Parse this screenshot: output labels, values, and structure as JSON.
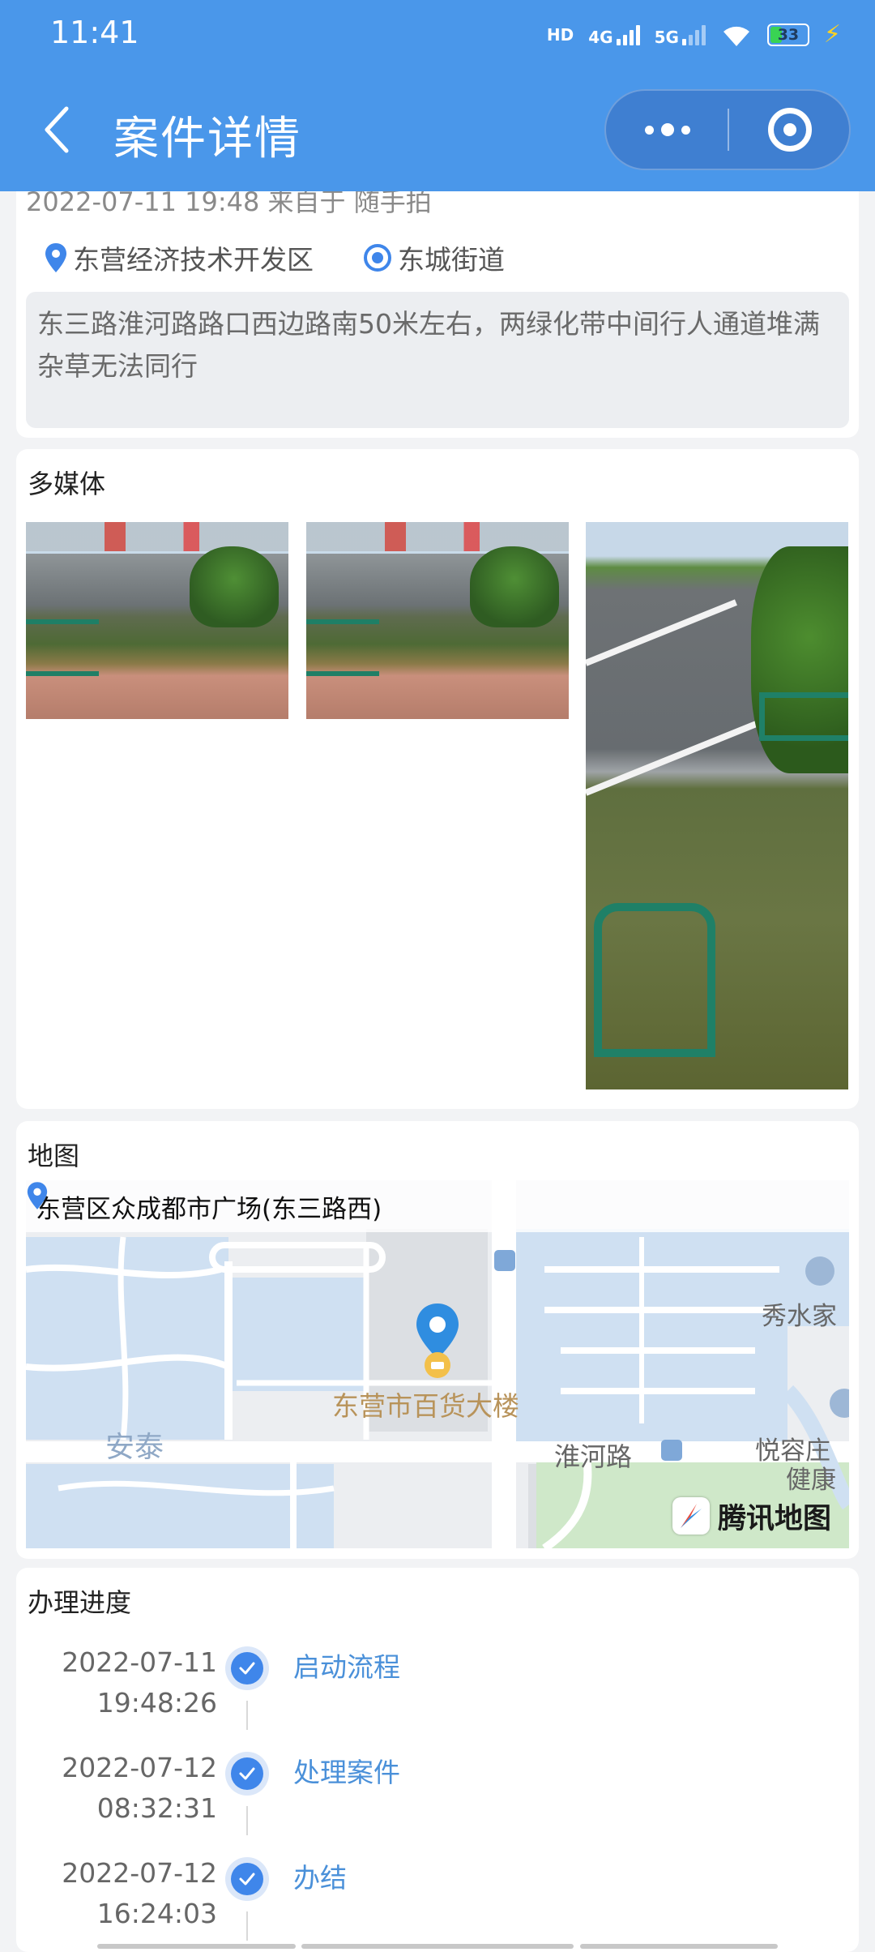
{
  "status_bar": {
    "time": "11:41",
    "hd": "HD",
    "net1": "4G",
    "net2": "5G",
    "battery": "33",
    "icons": [
      "hd-icon",
      "signal-4g-icon",
      "signal-5g-icon",
      "wifi-icon",
      "battery-icon",
      "charging-icon"
    ]
  },
  "nav": {
    "title": "案件详情",
    "back_icon": "chevron-left-icon",
    "more_icon": "more-dots-icon",
    "close_icon": "target-close-icon"
  },
  "case": {
    "meta": "2022-07-11 19:48 来自于 随手拍",
    "district": "东营经济技术开发区",
    "street": "东城街道",
    "description": "东三路淮河路路口西边路南50米左右，两绿化带中间行人通道堆满杂草无法同行"
  },
  "media": {
    "title": "多媒体",
    "photo_count": 3
  },
  "map": {
    "title": "地图",
    "address": "东营区众成都市广场(东三路西)",
    "poi_main": "东营市百货大楼",
    "labels": {
      "antai": "安泰",
      "huaihe_road": "淮河路",
      "xiushui": "秀水家",
      "yuerong": "悦容庄",
      "jiankang": "健康"
    },
    "provider": "腾讯地图",
    "colors": {
      "water": "#cfe0f2",
      "road": "#ffffff",
      "land": "#eef0f3",
      "green": "#cfe8c9",
      "poi_text": "#b8935a"
    }
  },
  "progress": {
    "title": "办理进度",
    "steps": [
      {
        "date": "2022-07-11",
        "time": "19:48:26",
        "label": "启动流程"
      },
      {
        "date": "2022-07-12",
        "time": "08:32:31",
        "label": "处理案件"
      },
      {
        "date": "2022-07-12",
        "time": "16:24:03",
        "label": "办结"
      }
    ]
  },
  "colors": {
    "header": "#4a97ea",
    "accent": "#3f86ea",
    "link": "#4a90d9"
  }
}
